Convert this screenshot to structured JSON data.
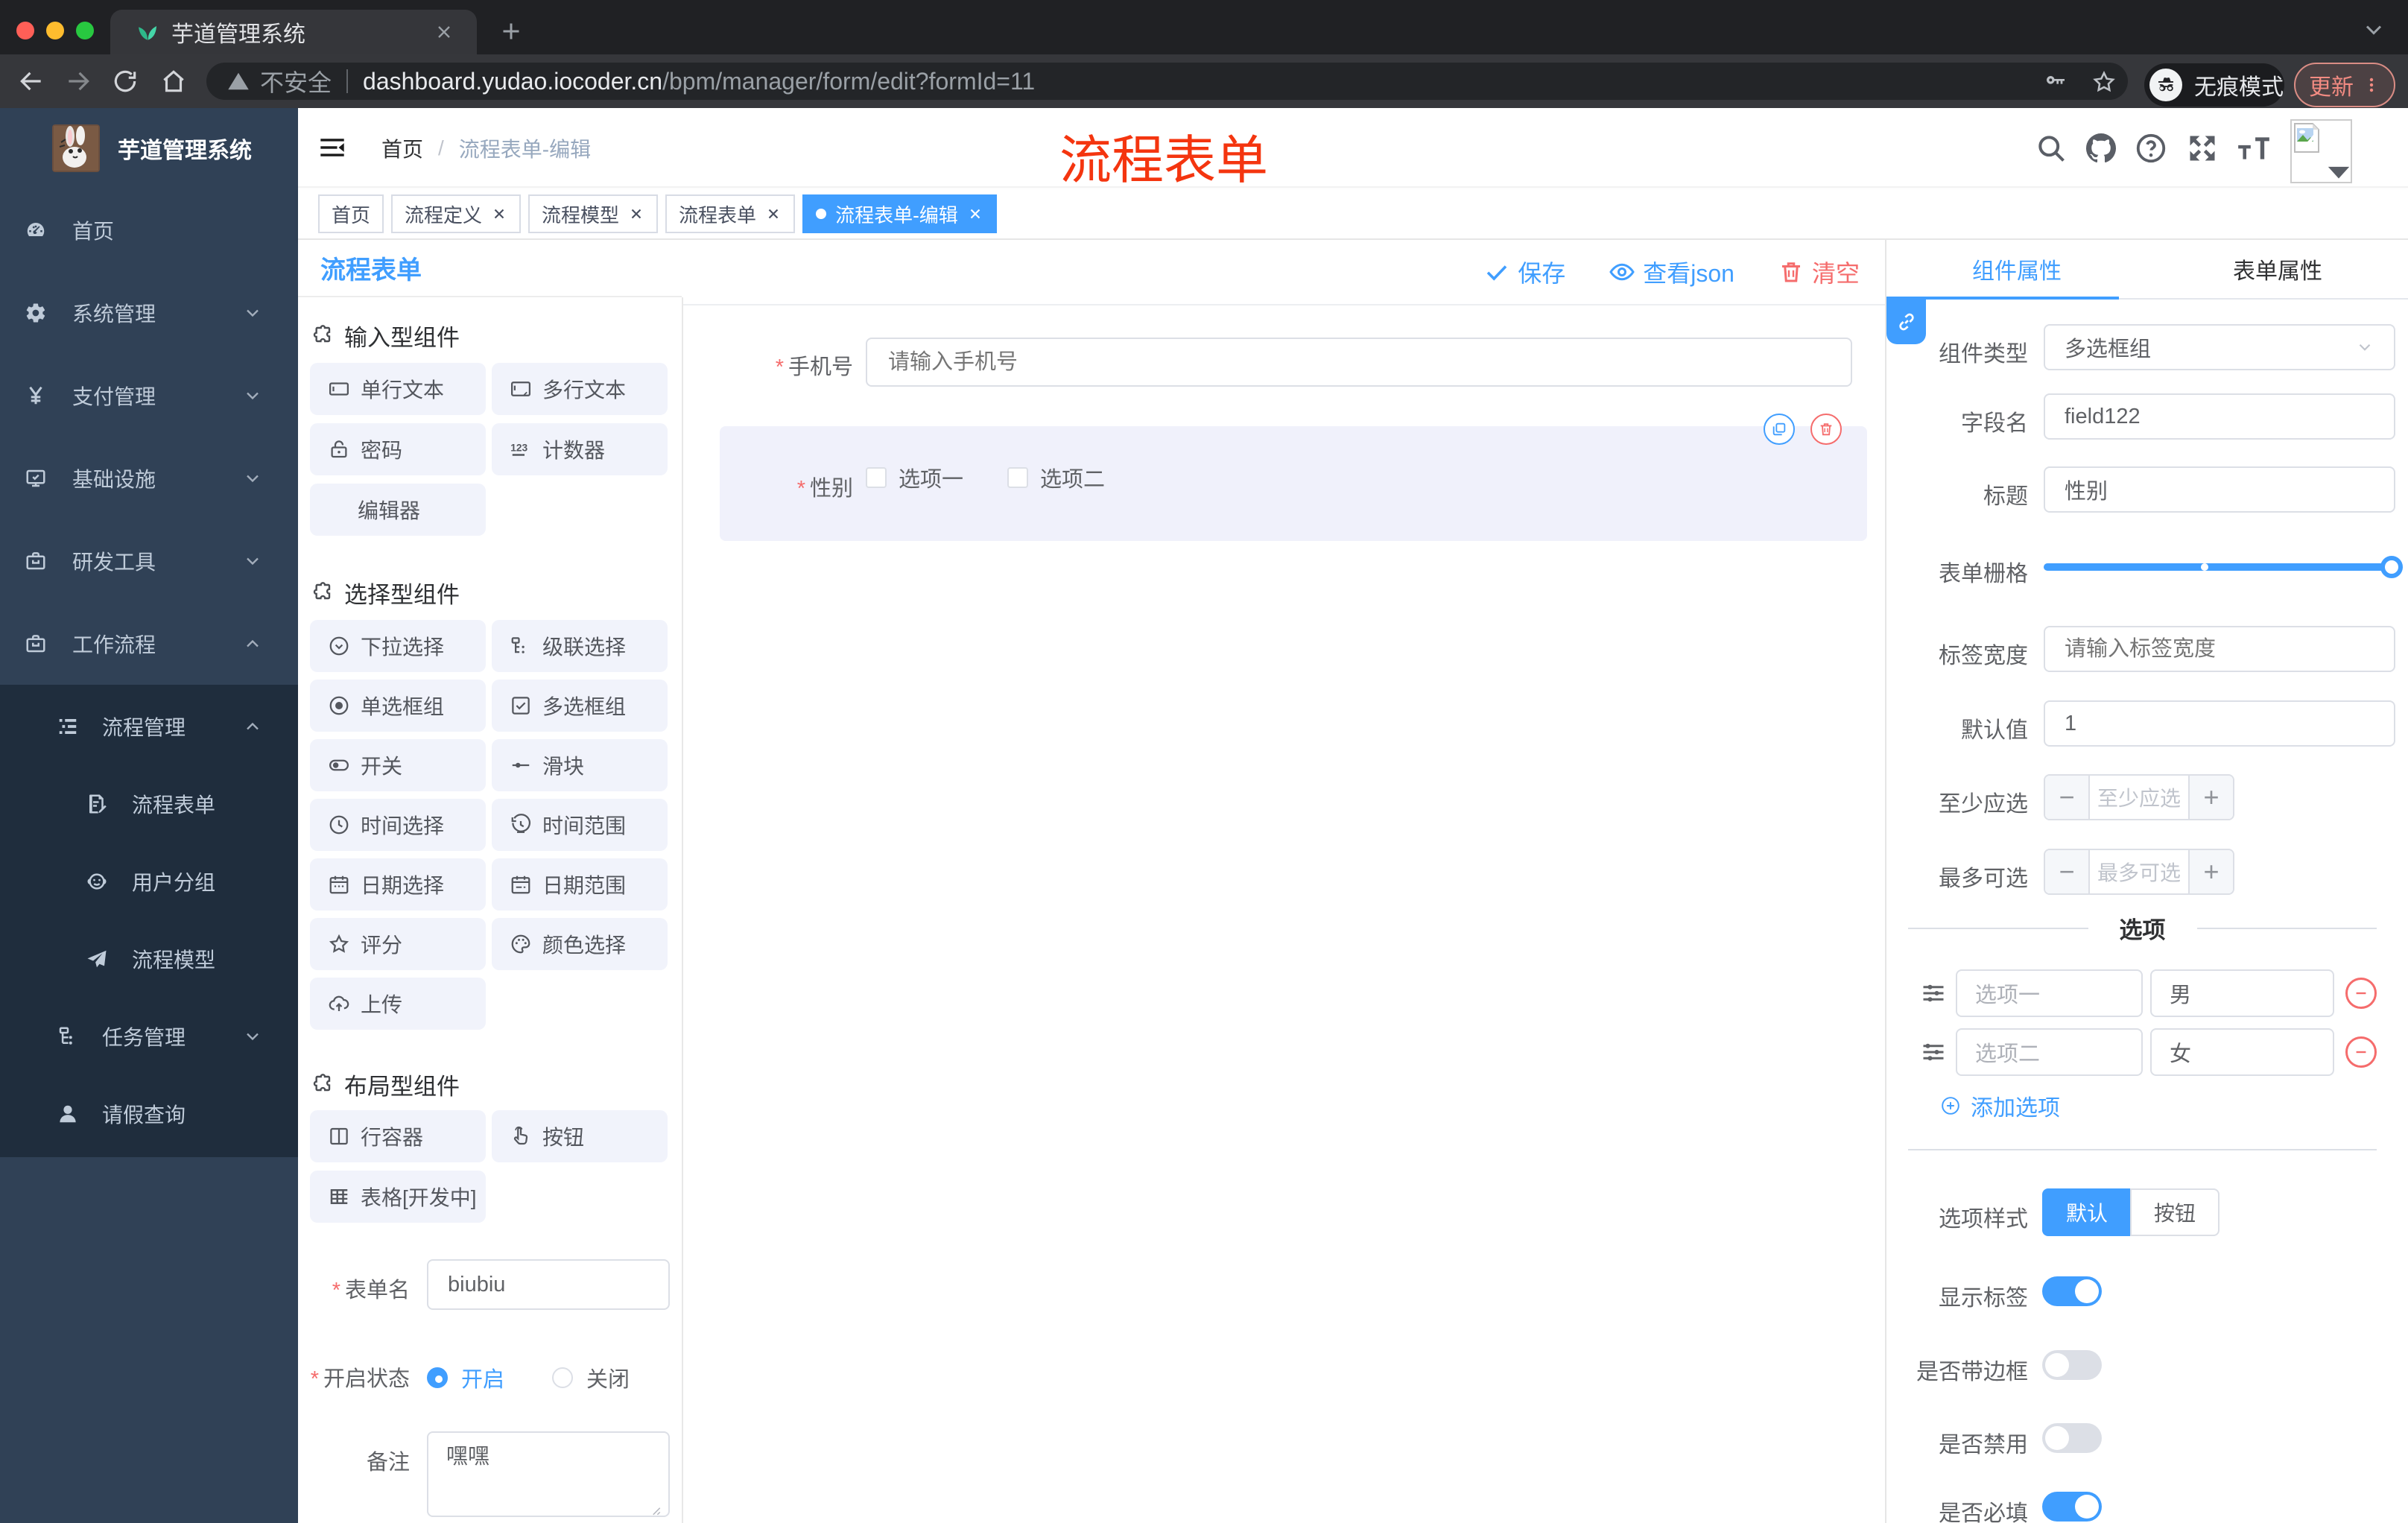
{
  "browser": {
    "tab_title": "芋道管理系统",
    "security_label": "不安全",
    "url_host": "dashboard.yudao.iocoder.cn",
    "url_path": "/bpm/manager/form/edit?formId=11",
    "incognito_label": "无痕模式",
    "update_label": "更新"
  },
  "sidebar": {
    "logo_title": "芋道管理系统",
    "items": [
      {
        "label": "首页"
      },
      {
        "label": "系统管理"
      },
      {
        "label": "支付管理"
      },
      {
        "label": "基础设施"
      },
      {
        "label": "研发工具"
      },
      {
        "label": "工作流程"
      },
      {
        "label": "流程管理"
      },
      {
        "label": "流程表单"
      },
      {
        "label": "用户分组"
      },
      {
        "label": "流程模型"
      },
      {
        "label": "任务管理"
      },
      {
        "label": "请假查询"
      }
    ]
  },
  "navbar": {
    "breadcrumb_home": "首页",
    "breadcrumb_current": "流程表单-编辑",
    "annotation": "流程表单"
  },
  "tags": [
    {
      "label": "首页"
    },
    {
      "label": "流程定义"
    },
    {
      "label": "流程模型"
    },
    {
      "label": "流程表单"
    },
    {
      "label": "流程表单-编辑"
    }
  ],
  "palette": {
    "title": "流程表单",
    "sections": [
      {
        "title": "输入型组件",
        "items": [
          "单行文本",
          "多行文本",
          "密码",
          "计数器",
          "编辑器"
        ]
      },
      {
        "title": "选择型组件",
        "items": [
          "下拉选择",
          "级联选择",
          "单选框组",
          "多选框组",
          "开关",
          "滑块",
          "时间选择",
          "时间范围",
          "日期选择",
          "日期范围",
          "评分",
          "颜色选择",
          "上传"
        ]
      },
      {
        "title": "布局型组件",
        "items": [
          "行容器",
          "按钮",
          "表格[开发中]"
        ]
      }
    ],
    "form": {
      "name_label": "表单名",
      "name_value": "biubiu",
      "status_label": "开启状态",
      "status_on": "开启",
      "status_off": "关闭",
      "remark_label": "备注",
      "remark_value": "嘿嘿"
    }
  },
  "canvas": {
    "save_label": "保存",
    "view_json_label": "查看json",
    "clear_label": "清空",
    "phone_label": "手机号",
    "phone_placeholder": "请输入手机号",
    "gender_label": "性别",
    "gender_option1": "选项一",
    "gender_option2": "选项二"
  },
  "props": {
    "tab_component": "组件属性",
    "tab_form": "表单属性",
    "rows": {
      "type_label": "组件类型",
      "type_value": "多选框组",
      "field_label": "字段名",
      "field_value": "field122",
      "title_label": "标题",
      "title_value": "性别",
      "grid_label": "表单栅格",
      "label_width_label": "标签宽度",
      "label_width_placeholder": "请输入标签宽度",
      "default_label": "默认值",
      "default_value": "1",
      "min_label": "至少应选",
      "min_placeholder": "至少应选",
      "max_label": "最多可选",
      "max_placeholder": "最多可选"
    },
    "options": {
      "divider": "选项",
      "rows": [
        {
          "label": "选项一",
          "value": "男"
        },
        {
          "label": "选项二",
          "value": "女"
        }
      ],
      "add_label": "添加选项"
    },
    "style": {
      "label": "选项样式",
      "default": "默认",
      "button": "按钮"
    },
    "switches": [
      {
        "label": "显示标签",
        "on": true
      },
      {
        "label": "是否带边框",
        "on": false
      },
      {
        "label": "是否禁用",
        "on": false
      },
      {
        "label": "是否必填",
        "on": true
      }
    ]
  },
  "colors": {
    "accent": "#409eff",
    "danger": "#f56c6c",
    "annotation_red": "#f4350f",
    "sidebar_bg": "#304156",
    "sidebar_sub_bg": "#1f2d3d",
    "active_block_bg": "#f0f1fb"
  }
}
